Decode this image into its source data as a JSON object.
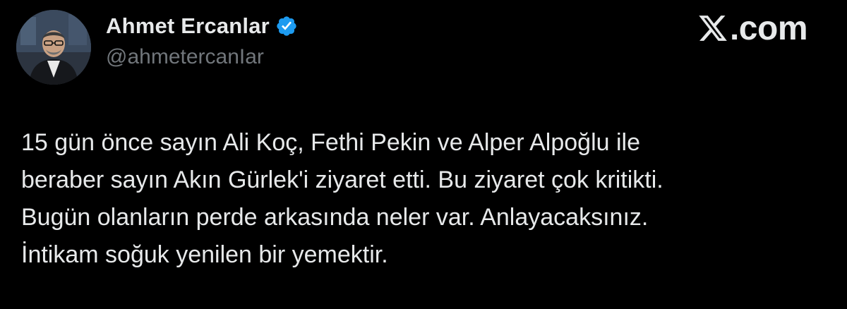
{
  "author": {
    "display_name": "Ahmet Ercanlar",
    "handle": "@ahmetercanIar",
    "verified": true
  },
  "brand": {
    "text": ".com",
    "icon": "x-logo-icon"
  },
  "tweet": {
    "lines": [
      "15 gün önce sayın Ali Koç, Fethi Pekin ve Alper Alpoğlu ile",
      "beraber sayın Akın Gürlek'i ziyaret etti. Bu ziyaret çok kritikti.",
      "Bugün olanların perde arkasında neler var. Anlayacaksınız.",
      "İntikam soğuk yenilen bir yemektir."
    ]
  },
  "colors": {
    "background": "#000000",
    "text_primary": "#e7e9ea",
    "text_secondary": "#71767b",
    "verified_blue": "#1d9bf0"
  }
}
